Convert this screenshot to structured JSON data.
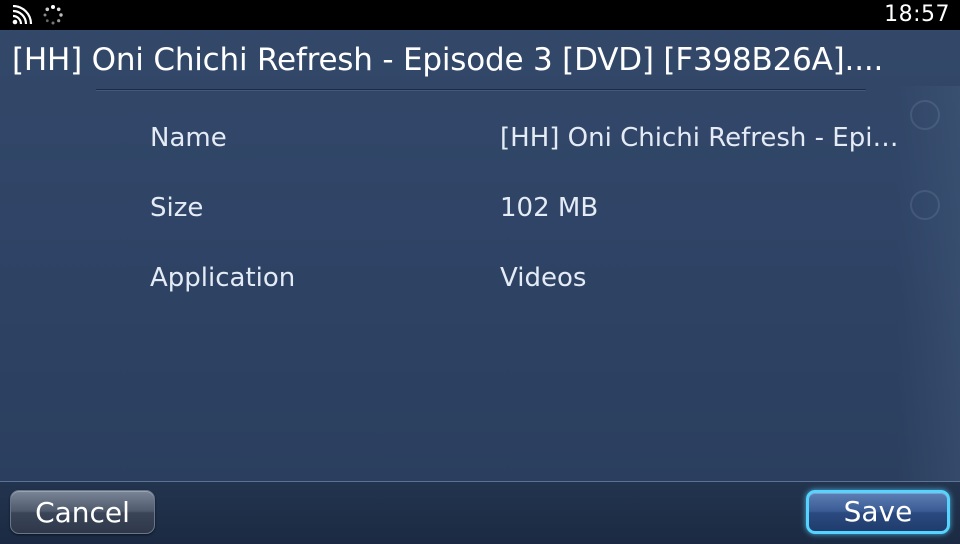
{
  "statusbar": {
    "time": "18:57",
    "icons": [
      "wifi-icon",
      "activity-icon"
    ]
  },
  "dialog": {
    "title": "[HH] Oni Chichi Refresh - Episode 3 [DVD] [F398B26A]....",
    "rows": [
      {
        "label": "Name",
        "value": "[HH] Oni Chichi Refresh - Epi…"
      },
      {
        "label": "Size",
        "value": "102 MB"
      },
      {
        "label": "Application",
        "value": "Videos"
      }
    ]
  },
  "buttons": {
    "cancel_label": "Cancel",
    "save_label": "Save"
  },
  "colors": {
    "background": "#2f4466",
    "accent_focus": "#55d4ff",
    "text": "#e4ebf5"
  }
}
